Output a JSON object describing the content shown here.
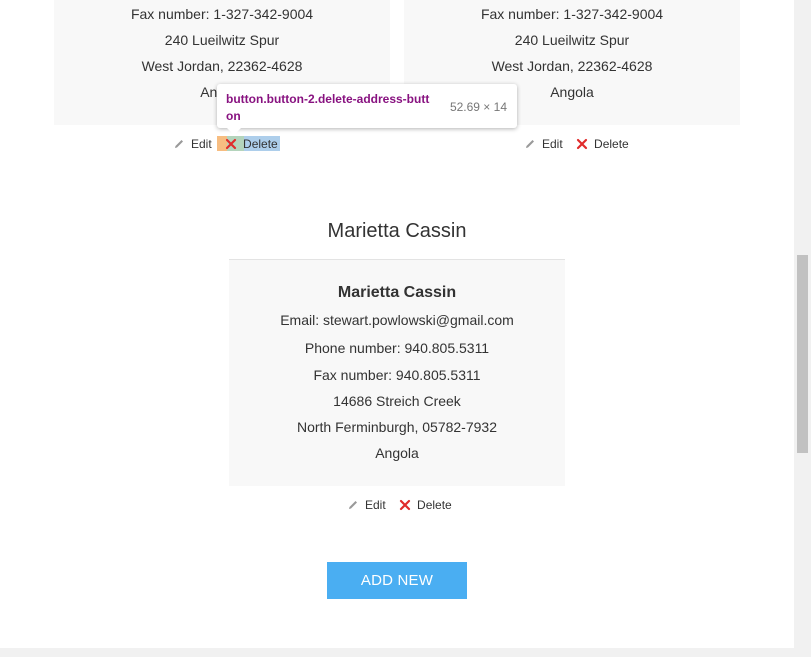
{
  "cards_top": [
    {
      "fax": "Fax number: 1-327-342-9004",
      "street": "240 Lueilwitz Spur",
      "city": "West Jordan, 22362-4628",
      "country": "Angola",
      "edit_label": "Edit",
      "delete_label": "Delete"
    },
    {
      "fax": "Fax number: 1-327-342-9004",
      "street": "240 Lueilwitz Spur",
      "city": "West Jordan, 22362-4628",
      "country": "Angola",
      "edit_label": "Edit",
      "delete_label": "Delete"
    }
  ],
  "second_section": {
    "title": "Marietta Cassin",
    "card": {
      "name": "Marietta Cassin",
      "email": "Email: stewart.powlowski@gmail.com",
      "phone": "Phone number: 940.805.5311",
      "fax": "Fax number: 940.805.5311",
      "street": "14686 Streich Creek",
      "city": "North Ferminburgh, 05782-7932",
      "country": "Angola"
    },
    "edit_label": "Edit",
    "delete_label": "Delete"
  },
  "add_button_label": "ADD NEW",
  "tooltip": {
    "selector": "button.button-2.delete-address-button",
    "dimensions": "52.69 × 14"
  },
  "colors": {
    "accent": "#4aaef2",
    "delete_red": "#e02b2b",
    "card_bg": "#f8f8f8",
    "selector_purple": "#881280"
  }
}
